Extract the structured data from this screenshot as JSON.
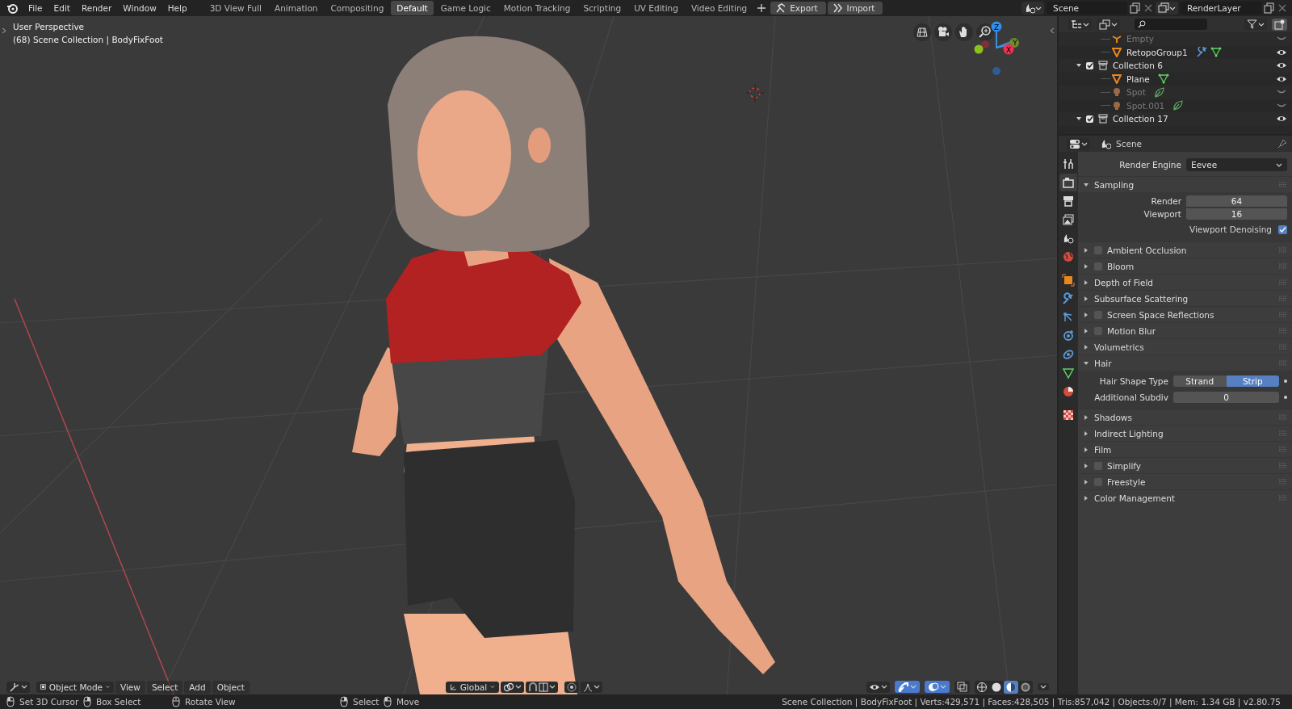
{
  "topbar": {
    "menus": [
      "File",
      "Edit",
      "Render",
      "Window",
      "Help"
    ],
    "workspaces": [
      {
        "label": "3D View Full",
        "selected": false
      },
      {
        "label": "Animation",
        "selected": false
      },
      {
        "label": "Compositing",
        "selected": false
      },
      {
        "label": "Default",
        "selected": true
      },
      {
        "label": "Game Logic",
        "selected": false
      },
      {
        "label": "Motion Tracking",
        "selected": false
      },
      {
        "label": "Scripting",
        "selected": false
      },
      {
        "label": "UV Editing",
        "selected": false
      },
      {
        "label": "Video Editing",
        "selected": false
      }
    ],
    "buttons": [
      "Export",
      "Import"
    ],
    "scene": "Scene",
    "view_layer": "RenderLayer"
  },
  "viewport": {
    "title": "User Perspective",
    "info": "(68) Scene Collection | BodyFixFoot",
    "gizmo_axes": [
      "Z",
      "Y",
      "X"
    ],
    "mode": "Object Mode",
    "menus": [
      "View",
      "Select",
      "Add",
      "Object"
    ],
    "orientation": "Global",
    "gizmos_on": true,
    "overlays_on": true,
    "shading": [
      {
        "selected": false
      },
      {
        "selected": false
      },
      {
        "selected": true
      },
      {
        "selected": false
      }
    ]
  },
  "outliner": {
    "rows": [
      {
        "kind": "empty",
        "name": "Empty",
        "visible": false,
        "has_modifier": false
      },
      {
        "kind": "mesh",
        "name": "RetopoGroup1",
        "visible": true,
        "has_modifier": true
      },
      {
        "kind": "collection",
        "name": "Collection 6",
        "expanded": true,
        "checked": true,
        "visible": true,
        "children": [
          {
            "kind": "mesh",
            "name": "Plane",
            "visible": true,
            "has_modifier": false
          },
          {
            "kind": "light",
            "name": "Spot",
            "visible": false,
            "has_modifier": false
          },
          {
            "kind": "light",
            "name": "Spot.001",
            "visible": false,
            "has_modifier": false
          }
        ]
      },
      {
        "kind": "collection",
        "name": "Collection 17",
        "expanded": true,
        "checked": true,
        "visible": true,
        "children": []
      }
    ]
  },
  "properties": {
    "context": "Scene",
    "tabs": [
      {
        "selected": false
      },
      {
        "selected": true
      },
      {
        "selected": false
      },
      {
        "selected": false
      },
      {
        "selected": false
      },
      {
        "selected": false
      },
      {
        "selected": false
      },
      {
        "selected": false
      },
      {
        "selected": false
      },
      {
        "selected": false
      },
      {
        "selected": false
      },
      {
        "selected": false
      },
      {
        "selected": false
      },
      {
        "selected": false
      }
    ],
    "render_engine": {
      "label": "Render Engine",
      "value": "Eevee"
    },
    "panels": [
      {
        "title": "Sampling",
        "expanded": true,
        "rows": [
          {
            "kind": "number",
            "label": "Render",
            "value": "64"
          },
          {
            "kind": "number",
            "label": "Viewport",
            "value": "16"
          },
          {
            "kind": "checkbox",
            "label": "Viewport Denoising",
            "checked": true
          }
        ]
      },
      {
        "title": "Ambient Occlusion",
        "expanded": false,
        "checked": false
      },
      {
        "title": "Bloom",
        "expanded": false,
        "checked": false
      },
      {
        "title": "Depth of Field",
        "expanded": false
      },
      {
        "title": "Subsurface Scattering",
        "expanded": false
      },
      {
        "title": "Screen Space Reflections",
        "expanded": false,
        "checked": false
      },
      {
        "title": "Motion Blur",
        "expanded": false,
        "checked": false
      },
      {
        "title": "Volumetrics",
        "expanded": false
      },
      {
        "title": "Hair",
        "expanded": true,
        "rows": [
          {
            "kind": "enum",
            "label": "Hair Shape Type",
            "options": [
              {
                "label": "Strand",
                "selected": false
              },
              {
                "label": "Strip",
                "selected": true
              }
            ]
          },
          {
            "kind": "slider",
            "label": "Additional Subdiv",
            "value": "0"
          }
        ]
      },
      {
        "title": "Shadows",
        "expanded": false
      },
      {
        "title": "Indirect Lighting",
        "expanded": false
      },
      {
        "title": "Film",
        "expanded": false
      },
      {
        "title": "Simplify",
        "expanded": false,
        "checked": false
      },
      {
        "title": "Freestyle",
        "expanded": false,
        "checked": false
      },
      {
        "title": "Color Management",
        "expanded": false
      }
    ]
  },
  "status_bar": {
    "hints": [
      "Set 3D Cursor",
      "Box Select",
      "Rotate View",
      "Select",
      "Move"
    ],
    "stats": "Scene Collection | BodyFixFoot | Verts:429,571 | Faces:428,505 | Tris:857,042 | Objects:0/7 | Mem: 1.34 GB | v2.80.75"
  }
}
